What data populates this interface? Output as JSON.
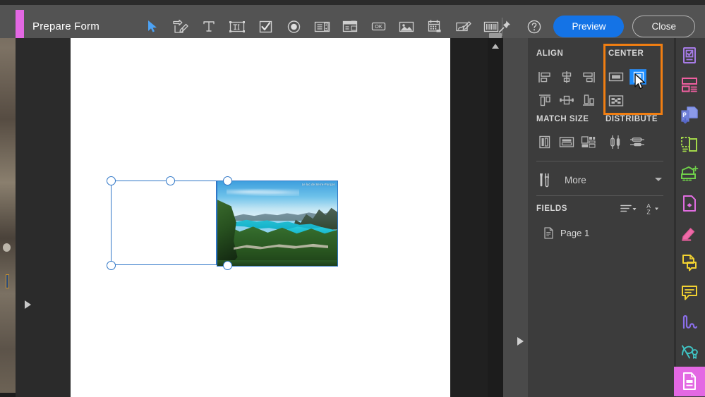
{
  "window": {
    "title": "Prepare Form",
    "accent_color": "#e368e3"
  },
  "toolbar": {
    "tools": [
      {
        "name": "select-tool",
        "label": "Select"
      },
      {
        "name": "add-field-tool",
        "label": "Add a new field"
      },
      {
        "name": "text-tool",
        "label": "Add Text"
      },
      {
        "name": "text-field-tool",
        "label": "Text Field"
      },
      {
        "name": "checkbox-tool",
        "label": "Check Box"
      },
      {
        "name": "radio-button-tool",
        "label": "Radio Button"
      },
      {
        "name": "list-box-tool",
        "label": "List Box"
      },
      {
        "name": "dropdown-tool",
        "label": "Dropdown"
      },
      {
        "name": "button-tool",
        "label": "Button"
      },
      {
        "name": "image-field-tool",
        "label": "Image Field"
      },
      {
        "name": "date-field-tool",
        "label": "Date Field"
      },
      {
        "name": "signature-tool",
        "label": "Digital Signature"
      },
      {
        "name": "barcode-tool",
        "label": "Barcode"
      }
    ],
    "pin_label": "Pin",
    "help_label": "Help",
    "preview_label": "Preview",
    "close_label": "Close"
  },
  "panel": {
    "align": {
      "title": "ALIGN",
      "buttons": [
        {
          "name": "align-left",
          "label": "Align Left"
        },
        {
          "name": "align-vertical-center",
          "label": "Align Vertical Center"
        },
        {
          "name": "align-right",
          "label": "Align Right"
        },
        {
          "name": "align-top",
          "label": "Align Top"
        },
        {
          "name": "align-horizontal-center",
          "label": "Align Horizontal Center"
        },
        {
          "name": "align-bottom",
          "label": "Align Bottom"
        }
      ]
    },
    "center": {
      "title": "CENTER",
      "highlight_color": "#f07e12",
      "selected_color": "#1a8cff",
      "buttons": [
        {
          "name": "center-horizontally",
          "label": "Center Horizontally",
          "selected": false
        },
        {
          "name": "center-vertically",
          "label": "Center Vertically",
          "selected": true
        },
        {
          "name": "center-both",
          "label": "Center Both",
          "selected": false
        }
      ]
    },
    "match_size": {
      "title": "MATCH SIZE",
      "buttons": [
        {
          "name": "match-width",
          "label": "Match Width"
        },
        {
          "name": "match-height",
          "label": "Match Height"
        },
        {
          "name": "match-both",
          "label": "Match Both"
        }
      ]
    },
    "distribute": {
      "title": "DISTRIBUTE",
      "buttons": [
        {
          "name": "distribute-vertically",
          "label": "Distribute Vertically"
        },
        {
          "name": "distribute-horizontally",
          "label": "Distribute Horizontally"
        }
      ]
    },
    "more": {
      "label": "More"
    },
    "fields": {
      "title": "FIELDS",
      "sort_order_label": "Sort order",
      "sort_alpha_label": "Sort alphabetically",
      "items": [
        {
          "name": "fields-page-1",
          "label": "Page 1"
        }
      ]
    }
  },
  "canvas": {
    "image_caption": "Le lac de Serre-Ponçon",
    "selection_color": "#2f76c7",
    "objects": [
      {
        "name": "empty-form-field",
        "type": "field"
      },
      {
        "name": "image-object",
        "type": "image"
      }
    ]
  },
  "rail": {
    "items": [
      {
        "name": "rail-prepare-form",
        "label": "Prepare Form",
        "color": "#a77ce8",
        "active": false
      },
      {
        "name": "rail-fill-sign",
        "label": "Fill & Sign",
        "color": "#ef5fa0",
        "active": false
      },
      {
        "name": "rail-export-pdf",
        "label": "Export PDF",
        "color": "#7b8ce8",
        "active": false
      },
      {
        "name": "rail-organize-pages",
        "label": "Organize Pages",
        "color": "#a3d94a",
        "active": false
      },
      {
        "name": "rail-enhance-scans",
        "label": "Enhance Scans",
        "color": "#6fcf4a",
        "active": false
      },
      {
        "name": "rail-redact",
        "label": "Redact",
        "color": "#e06de0",
        "active": false
      },
      {
        "name": "rail-highlight",
        "label": "Highlight Text",
        "color": "#ef6aa8",
        "active": false
      },
      {
        "name": "rail-add-comment",
        "label": "Add Sticky Note",
        "color": "#f2d231",
        "active": false
      },
      {
        "name": "rail-comment",
        "label": "Comment",
        "color": "#f2d231",
        "active": false
      },
      {
        "name": "rail-draw",
        "label": "Draw Free Form",
        "color": "#8a6ee8",
        "active": false
      },
      {
        "name": "rail-certificates",
        "label": "Certificates",
        "color": "#3fc4c4",
        "active": false
      },
      {
        "name": "rail-active-tool",
        "label": "Prepare Form",
        "color": "#ffffff",
        "active": true
      }
    ]
  }
}
